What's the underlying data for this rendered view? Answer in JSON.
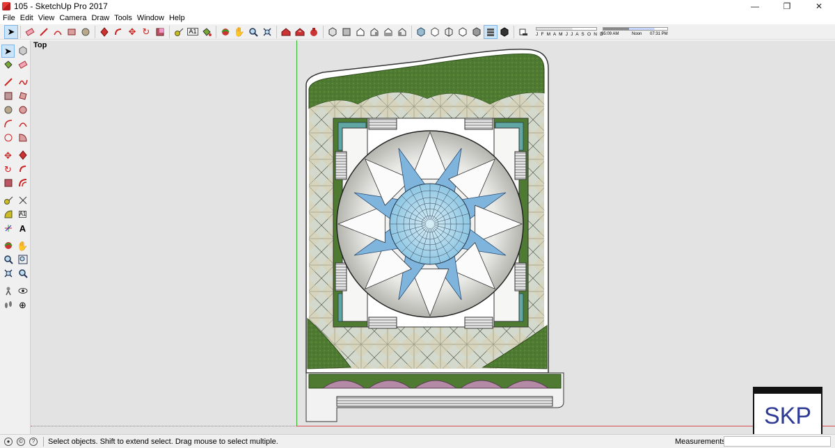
{
  "window": {
    "title": "105 - SketchUp Pro 2017",
    "controls": {
      "minimize": "—",
      "maximize": "❐",
      "close": "✕"
    }
  },
  "menu": [
    "File",
    "Edit",
    "View",
    "Camera",
    "Draw",
    "Tools",
    "Window",
    "Help"
  ],
  "toolbar": {
    "shadow_months": "J F M A M J J A S O N D",
    "shadow_time_start": "05:09 AM",
    "shadow_time_noon": "Noon",
    "shadow_time_end": "07:31 PM"
  },
  "viewport": {
    "view_name": "Top",
    "badge": "SKP"
  },
  "status": {
    "message": "Select objects. Shift to extend select. Drag mouse to select multiple.",
    "measurements_label": "Measurements",
    "measurements_value": ""
  },
  "colors": {
    "accent_active": "#cce4f7",
    "lawn_green": "#4f7a32",
    "axis_green": "#2fb52f",
    "axis_red": "#d34b4b",
    "skp_blue": "#2f3a94"
  }
}
